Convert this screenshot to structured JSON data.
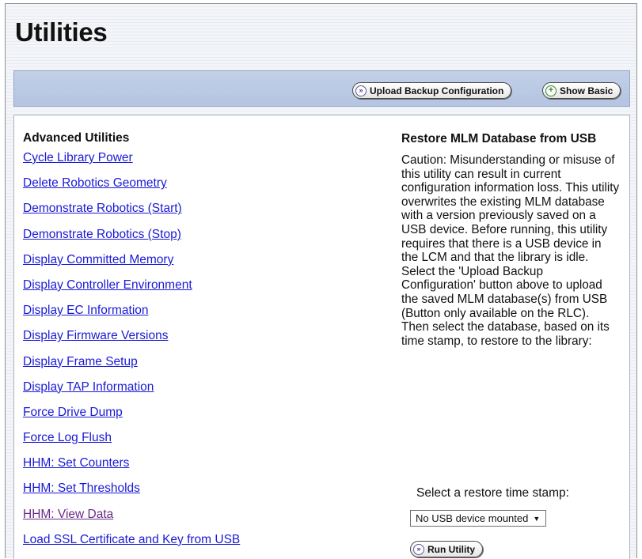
{
  "page": {
    "title": "Utilities"
  },
  "toolbar": {
    "upload_label": "Upload Backup Configuration",
    "show_basic_label": "Show Basic"
  },
  "advanced": {
    "heading": "Advanced Utilities",
    "links": [
      "Cycle Library Power",
      "Delete Robotics Geometry",
      "Demonstrate Robotics (Start)",
      "Demonstrate Robotics (Stop)",
      "Display Committed Memory",
      "Display Controller Environment",
      "Display EC Information",
      "Display Firmware Versions",
      "Display Frame Setup",
      "Display TAP Information",
      "Force Drive Dump",
      "Force Log Flush",
      "HHM: Set Counters",
      "HHM: Set Thresholds",
      "HHM: View Data",
      "Load SSL Certificate and Key from USB"
    ]
  },
  "restore": {
    "title": "Restore MLM Database from USB",
    "caution": "Caution: Misunderstanding or misuse of this utility can result in current configuration information loss. This utility overwrites the existing MLM database with a version previously saved on a USB device. Before running, this utility requires that there is a USB device in the LCM and that the library is idle. Select the 'Upload Backup Configuration' button above to upload the saved MLM database(s) from USB (Button only available on the RLC). Then select the database, based on its time stamp, to restore to the library:",
    "select_label": "Select a restore time stamp:",
    "select_value": "No USB device mounted",
    "run_label": "Run Utility"
  },
  "icons": {
    "upload": "double-chevron-right-icon",
    "show_basic": "plus-circle-icon",
    "run": "double-chevron-right-icon",
    "dropdown": "triangle-down-icon"
  },
  "colors": {
    "link": "#1a1ad6",
    "visited_link": "#6b2a8a",
    "toolbar_bg": "#b4c4e1"
  }
}
